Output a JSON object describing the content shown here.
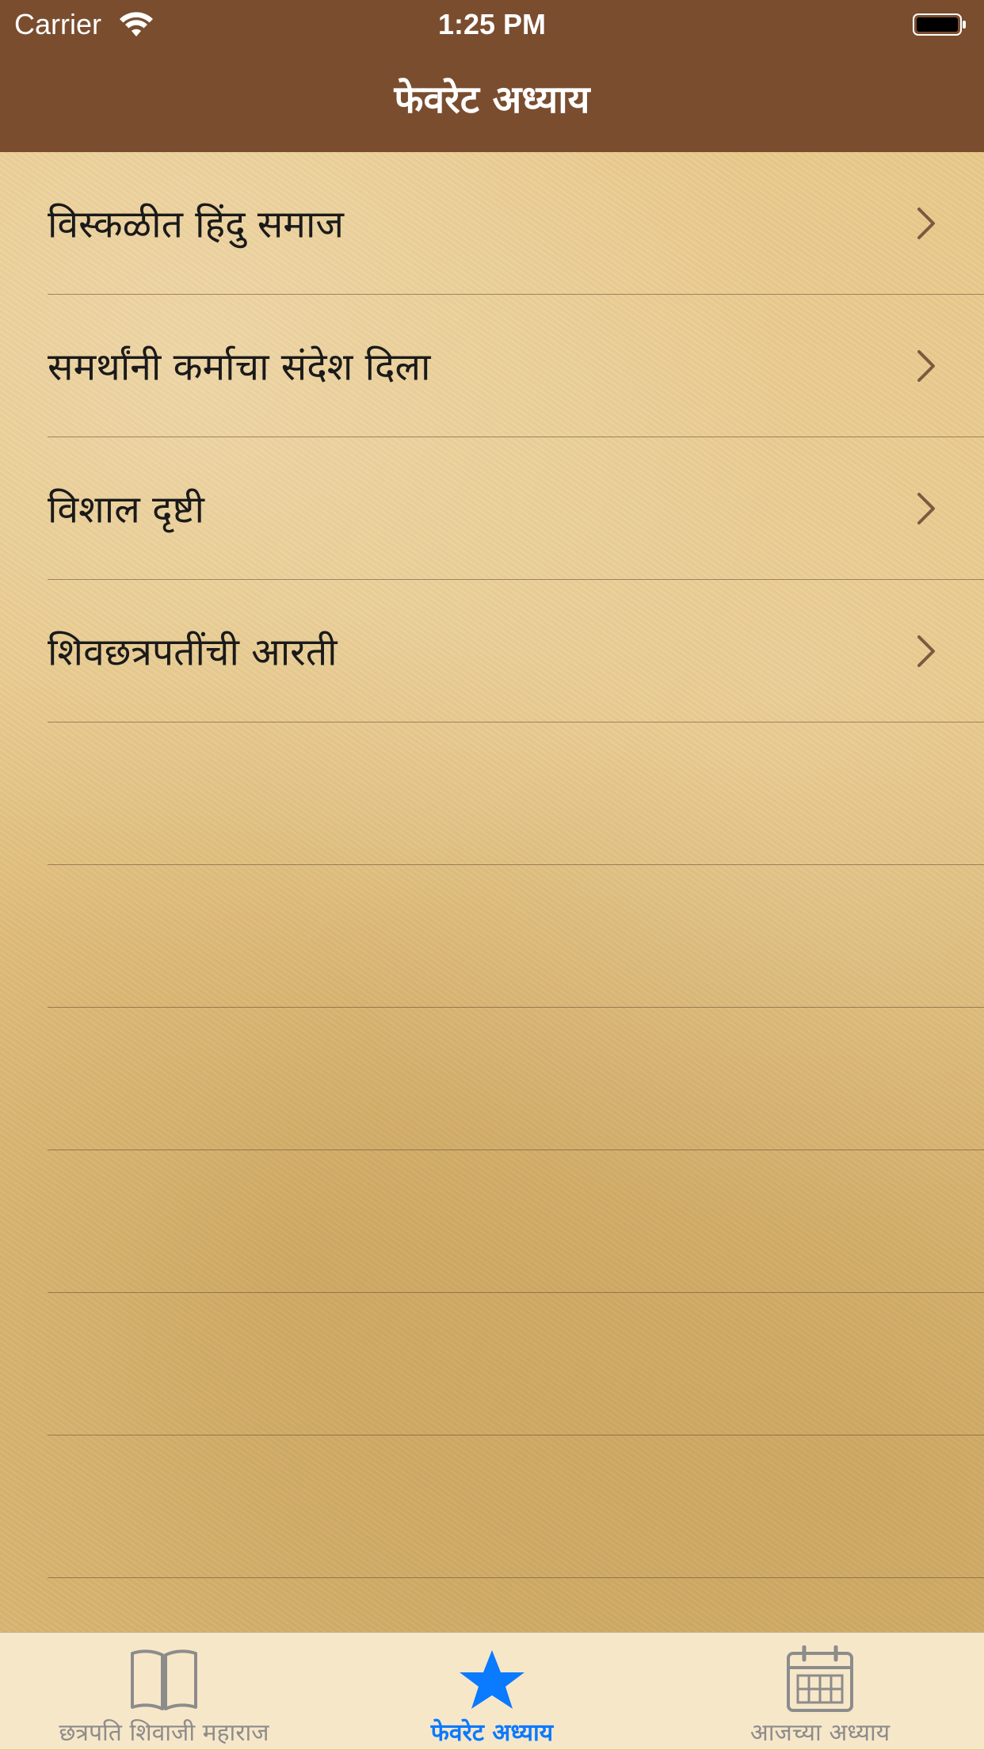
{
  "status_bar": {
    "carrier": "Carrier",
    "time": "1:25 PM"
  },
  "nav": {
    "title": "फेवरेट अध्याय"
  },
  "list": {
    "items": [
      {
        "label": "विस्कळीत हिंदु समाज"
      },
      {
        "label": "समर्थांनी कर्माचा संदेश दिला"
      },
      {
        "label": "विशाल दृष्टी"
      },
      {
        "label": "शिवछत्रपतींची आरती"
      },
      {
        "label": ""
      },
      {
        "label": ""
      },
      {
        "label": ""
      },
      {
        "label": ""
      },
      {
        "label": ""
      },
      {
        "label": ""
      }
    ]
  },
  "tab_bar": {
    "tabs": [
      {
        "label": "छत्रपति शिवाजी महाराज",
        "icon": "book-icon",
        "active": false
      },
      {
        "label": "फेवरेट अध्याय",
        "icon": "star-icon",
        "active": true
      },
      {
        "label": "आजच्या अध्याय",
        "icon": "calendar-icon",
        "active": false
      }
    ]
  },
  "colors": {
    "nav_background": "#7a4d2f",
    "tab_active": "#0a7aff",
    "tab_inactive": "#8c8c8c",
    "chevron": "#7a5a40"
  }
}
